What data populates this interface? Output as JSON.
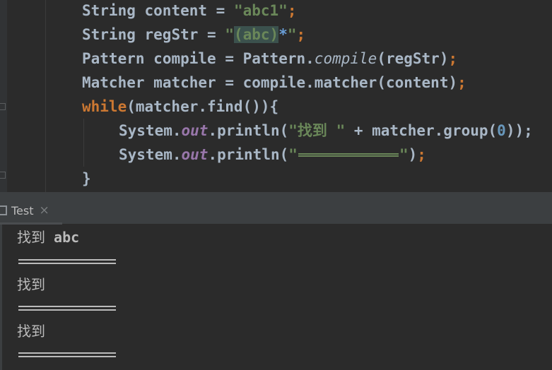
{
  "editor": {
    "lines": [
      {
        "type_name": "String",
        "var_name": "content",
        "value": "\"abc1\""
      },
      {
        "type_name": "String",
        "var_name": "regStr",
        "open_quote": "\"",
        "group": "(abc)",
        "quant": "*",
        "close_quote": "\""
      },
      {
        "type_name": "Pattern",
        "var_name": "compile",
        "cls": "Pattern",
        "method": "compile",
        "arg": "regStr"
      },
      {
        "type_name": "Matcher",
        "var_name": "matcher",
        "obj": "compile",
        "method": "matcher",
        "arg": "content"
      },
      {
        "keyword": "while",
        "expr": "(matcher.find()){"
      },
      {
        "cls": "System",
        "field": "out",
        "method": "println",
        "str": "\"找到 \"",
        "rest": " + matcher.group(",
        "num": "0",
        "close": "));"
      },
      {
        "cls": "System",
        "field": "out",
        "method": "println",
        "open_quote": "\"",
        "close_quote": "\""
      },
      {
        "brace": "}"
      }
    ]
  },
  "run_panel": {
    "tab_label": "Test",
    "close_glyph": "×",
    "output": [
      {
        "cjk": "找到",
        "latin": " abc"
      },
      {
        "separator": "=========="
      },
      {
        "cjk": "找到",
        "latin": ""
      },
      {
        "separator": "=========="
      },
      {
        "cjk": "找到",
        "latin": ""
      },
      {
        "separator": "=========="
      }
    ]
  },
  "colors": {
    "editor_bg": "#2b2b2b",
    "keyword": "#cc7832",
    "string": "#6a8759",
    "plain": "#a9b7c6",
    "static_field": "#9876aa",
    "number": "#6897bb",
    "toolbar_bg": "#3c3f41"
  }
}
